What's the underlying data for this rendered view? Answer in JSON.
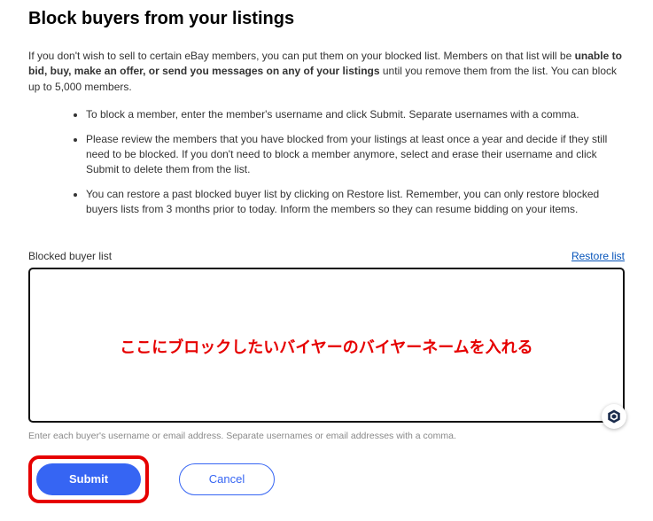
{
  "page": {
    "title": "Block buyers from your listings"
  },
  "intro": {
    "part1": "If you don't wish to sell to certain eBay members, you can put them on your blocked list. Members on that list will be ",
    "bold": "unable to bid, buy, make an offer, or send you messages on any of your listings",
    "part2": " until you remove them from the list. You can block up to 5,000 members."
  },
  "tips": [
    "To block a member, enter the member's username and click Submit. Separate usernames with a comma.",
    "Please review the members that you have blocked from your listings at least once a year and decide if they still need to be blocked. If you don't need to block a member anymore, select and erase their username and click Submit to delete them from the list.",
    "You can restore a past blocked buyer list by clicking on Restore list. Remember, you can only restore blocked buyers lists from 3 months prior to today. Inform the members so they can resume bidding on your items."
  ],
  "list": {
    "label": "Blocked buyer list",
    "restore": "Restore list",
    "value": "",
    "annotation": "ここにブロックしたいバイヤーのバイヤーネームを入れる",
    "helper": "Enter each buyer's username or email address. Separate usernames or email addresses with a comma."
  },
  "buttons": {
    "submit": "Submit",
    "cancel": "Cancel"
  }
}
